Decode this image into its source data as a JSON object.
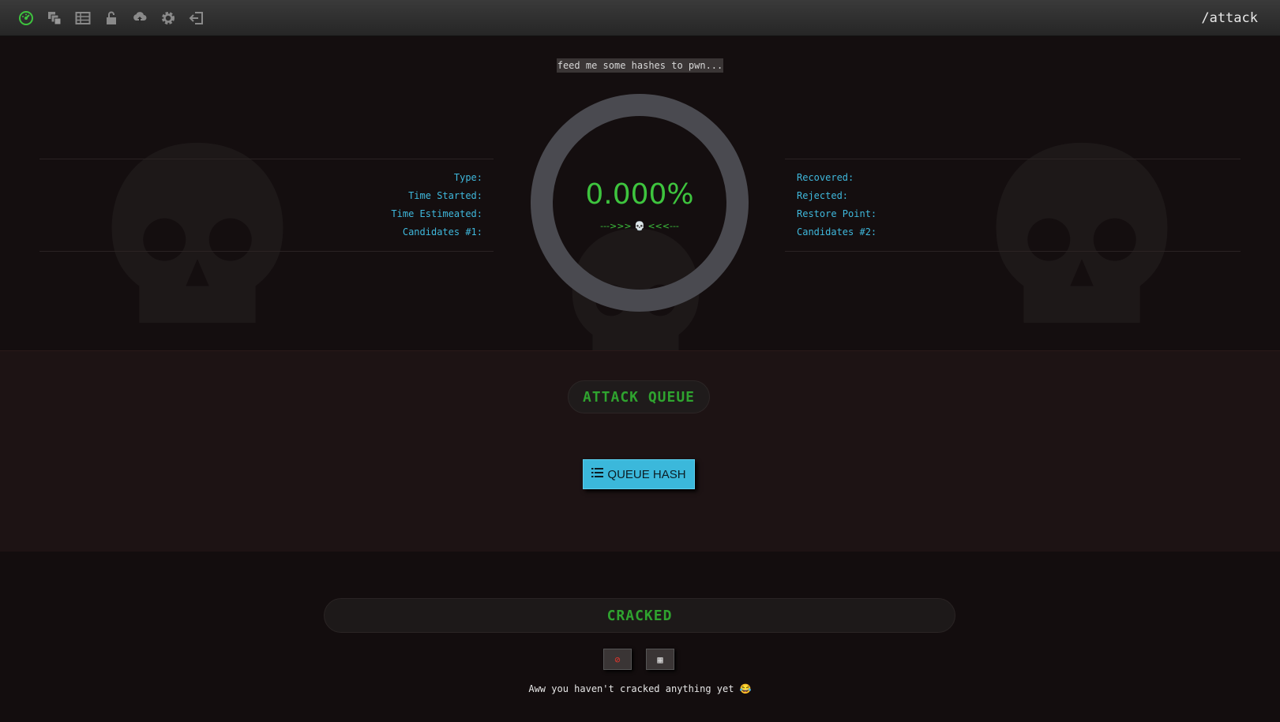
{
  "nav": {
    "icons": [
      "dashboard-icon",
      "queue-icon",
      "table-icon",
      "unlock-icon",
      "upload-icon",
      "settings-icon",
      "logout-icon"
    ],
    "active_color": "#3ec43e",
    "route": "/attack"
  },
  "status": {
    "tagline": "feed me some hashes to pwn...",
    "progress_percent": "0.000%",
    "progress_fraction": 0,
    "skull_line": "--->>> 💀 <<<---",
    "left_labels": [
      "Type:",
      "Time Started:",
      "Time Estimeated:",
      "Candidates #1:"
    ],
    "right_labels": [
      "Recovered:",
      "Rejected:",
      "Restore Point:",
      "Candidates #2:"
    ]
  },
  "queue": {
    "title": "ATTACK QUEUE",
    "button_label": "QUEUE HASH"
  },
  "cracked": {
    "title": "CRACKED",
    "clear_symbol": "⊘",
    "grid_symbol": "▦",
    "empty_message": "Aww you haven't cracked anything yet 😂"
  },
  "colors": {
    "accent_green": "#3ec43e",
    "label_blue": "#3fb8dc",
    "button_blue": "#3bb8db",
    "danger_red": "#e0352b"
  }
}
